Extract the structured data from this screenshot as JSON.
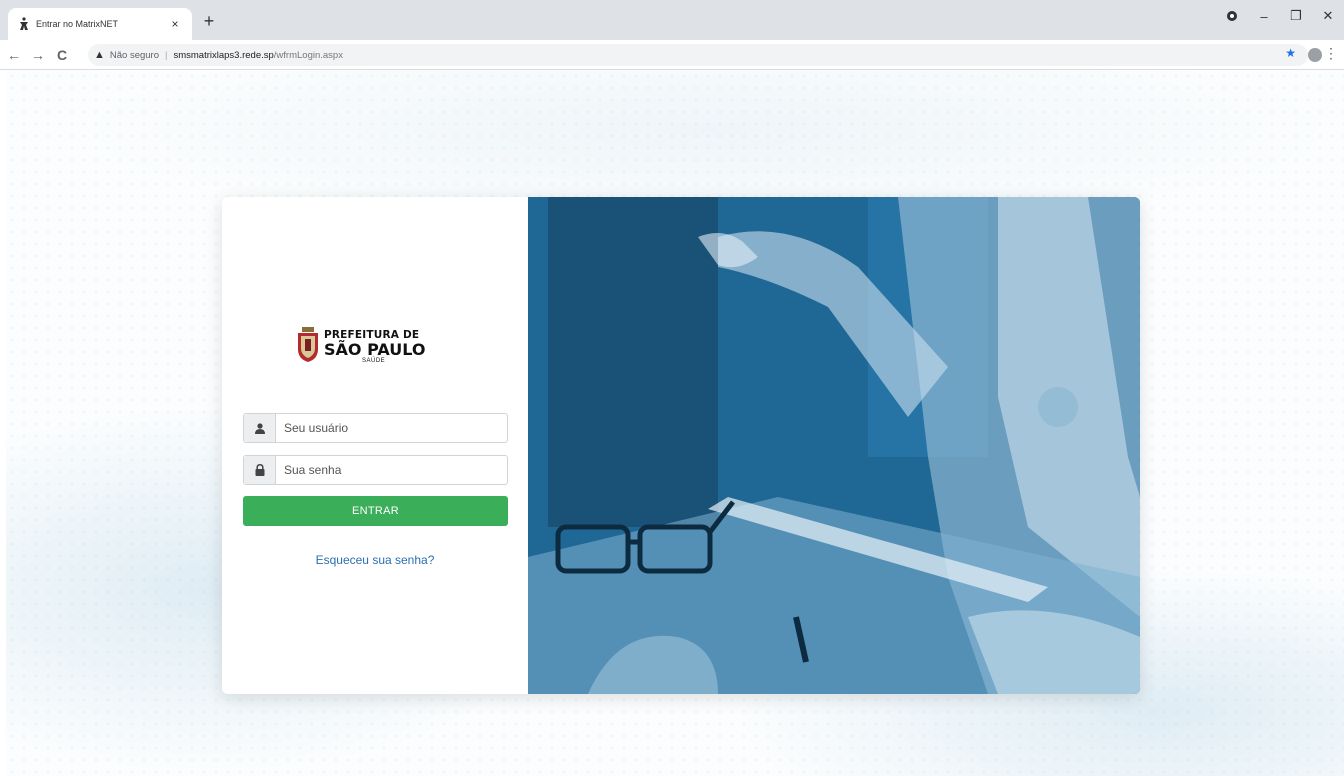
{
  "browser": {
    "tab_title": "Entrar no MatrixNET",
    "tab_close": "×",
    "new_tab": "+",
    "security_label": "Não seguro",
    "url_host": "smsmatrixlaps3.rede.sp",
    "url_path": "/wfrmLogin.aspx",
    "minimize": "–",
    "restore": "❐",
    "close": "✕",
    "back": "←",
    "forward": "→",
    "reload": "C",
    "menu": "⋮",
    "star": "★"
  },
  "logo": {
    "line1": "PREFEITURA DE",
    "line2": "SÃO PAULO",
    "line3": "SAÚDE"
  },
  "login": {
    "username_placeholder": "Seu usuário",
    "password_placeholder": "Sua senha",
    "submit_label": "ENTRAR",
    "forgot_label": "Esqueceu sua senha?"
  },
  "icons": {
    "favicon": "matrix-logo-icon",
    "user": "user-icon",
    "lock": "lock-icon",
    "warning": "warning-icon",
    "hero": "doctor-photo"
  },
  "colors": {
    "primary_button": "#3aae58",
    "link": "#2a6fb0",
    "hero_tint": "#2a7db0"
  }
}
